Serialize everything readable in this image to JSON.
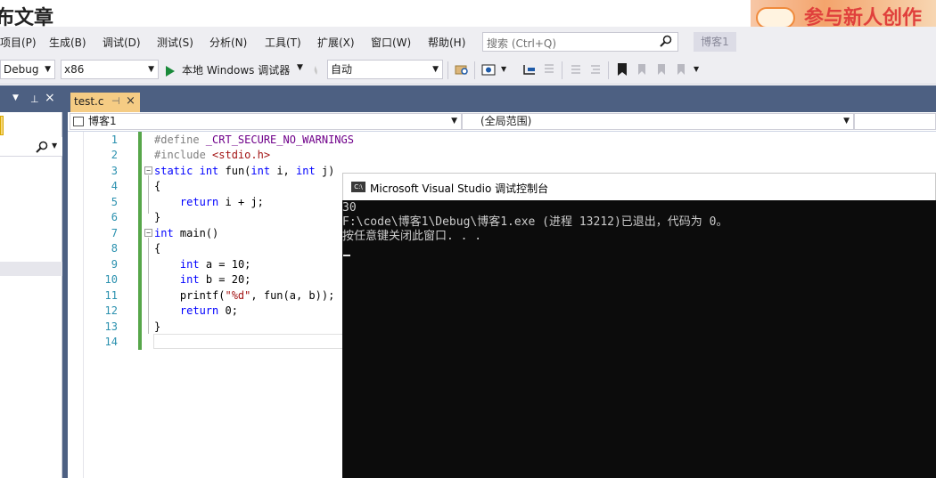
{
  "background_page": {
    "heading": "布文章",
    "banner_text": "参与新人创作"
  },
  "menu": {
    "items": [
      "项目(P)",
      "生成(B)",
      "调试(D)",
      "测试(S)",
      "分析(N)",
      "工具(T)",
      "扩展(X)",
      "窗口(W)",
      "帮助(H)"
    ],
    "search_placeholder": "搜索 (Ctrl+Q)",
    "project_badge": "博客1"
  },
  "toolbar": {
    "configuration": "Debug",
    "platform": "x86",
    "run_label": "本地 Windows 调试器",
    "run_mode": "自动"
  },
  "editor": {
    "tab_label": "test.c",
    "nav_project": "博客1",
    "nav_scope": "(全局范围)",
    "line_numbers": [
      "1",
      "2",
      "3",
      "4",
      "5",
      "6",
      "7",
      "8",
      "9",
      "10",
      "11",
      "12",
      "13",
      "14"
    ],
    "code_lines": [
      "#define _CRT_SECURE_NO_WARNINGS",
      "#include <stdio.h>",
      "static int fun(int i, int j)",
      "{",
      "    return i + j;",
      "}",
      "int main()",
      "{",
      "    int a = 10;",
      "    int b = 20;",
      "    printf(\"%d\", fun(a, b));",
      "    return 0;",
      "}",
      ""
    ]
  },
  "console": {
    "title": "Microsoft Visual Studio 调试控制台",
    "icon_label": "C:\\",
    "lines": [
      "30",
      "F:\\code\\博客1\\Debug\\博客1.exe (进程 13212)已退出，代码为 0。",
      "按任意键关闭此窗口. . ."
    ]
  },
  "colors": {
    "menu_bg": "#eeeef2",
    "panel_header": "#4d6082",
    "active_tab": "#f5cc84",
    "change_bar": "#57a64a",
    "keyword": "#0000ff",
    "console_bg": "#0c0c0c"
  }
}
